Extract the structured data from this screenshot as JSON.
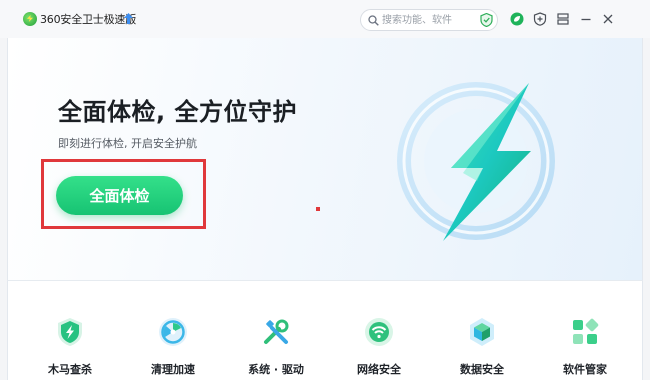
{
  "app": {
    "title": "360安全卫士极速版"
  },
  "search": {
    "placeholder": "搜索功能、软件"
  },
  "titlebar_icons": [
    "leaf-icon",
    "plus-shield-icon",
    "menu-icon",
    "minimize-icon",
    "close-icon"
  ],
  "hero": {
    "title": "全面体检, 全方位守护",
    "subtitle": "即刻进行体检, 开启安全护航",
    "button_label": "全面体检"
  },
  "tools": [
    {
      "label": "木马查杀",
      "icon": "trojan-shield-icon"
    },
    {
      "label": "清理加速",
      "icon": "cleanup-fan-icon"
    },
    {
      "label": "系统 · 驱动",
      "icon": "system-tools-icon"
    },
    {
      "label": "网络安全",
      "icon": "wifi-shield-icon"
    },
    {
      "label": "数据安全",
      "icon": "data-cube-icon"
    },
    {
      "label": "软件管家",
      "icon": "app-store-icon"
    }
  ],
  "colors": {
    "accent_green": "#1ec878",
    "highlight_red": "#e0383b",
    "title_text": "#1b1f24"
  }
}
